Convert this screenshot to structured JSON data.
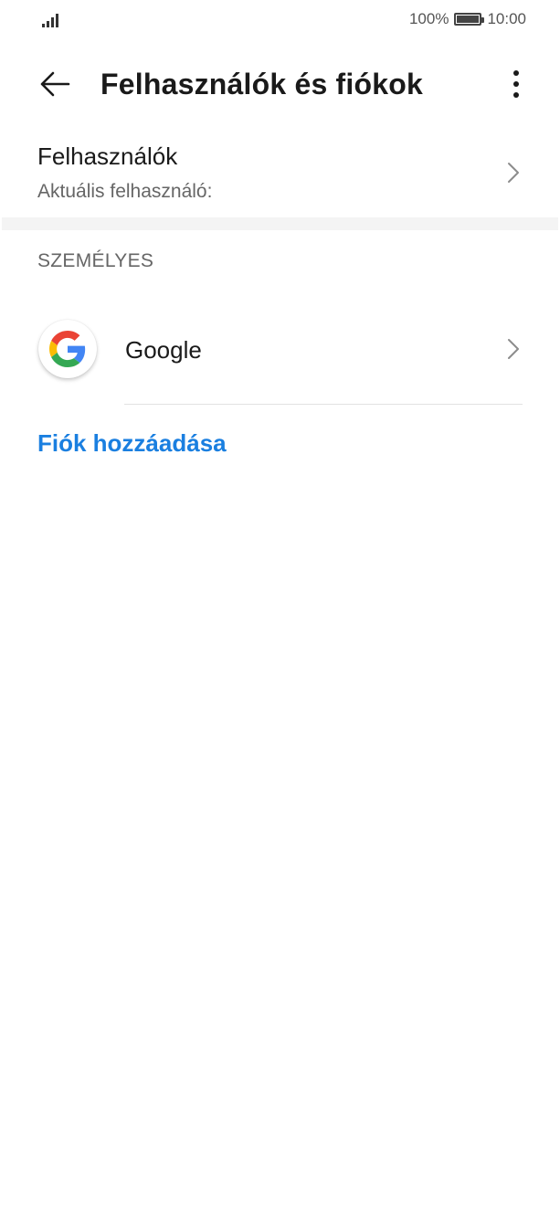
{
  "status_bar": {
    "battery_percent": "100%",
    "time": "10:00",
    "signal_icon": "signal-icon",
    "battery_icon": "battery-icon"
  },
  "app_bar": {
    "title": "Felhasználók és fiókok",
    "back_icon": "back-arrow-icon",
    "more_icon": "more-vertical-icon"
  },
  "users": {
    "title": "Felhasználók",
    "subtitle": "Aktuális felhasználó:"
  },
  "section": {
    "header": "SZEMÉLYES"
  },
  "accounts": [
    {
      "label": "Google",
      "icon": "google-icon"
    }
  ],
  "add_account": {
    "label": "Fiók hozzáadása"
  },
  "colors": {
    "accent": "#1a7fe0",
    "divider": "#e2e2e2",
    "band": "#f4f4f4"
  }
}
